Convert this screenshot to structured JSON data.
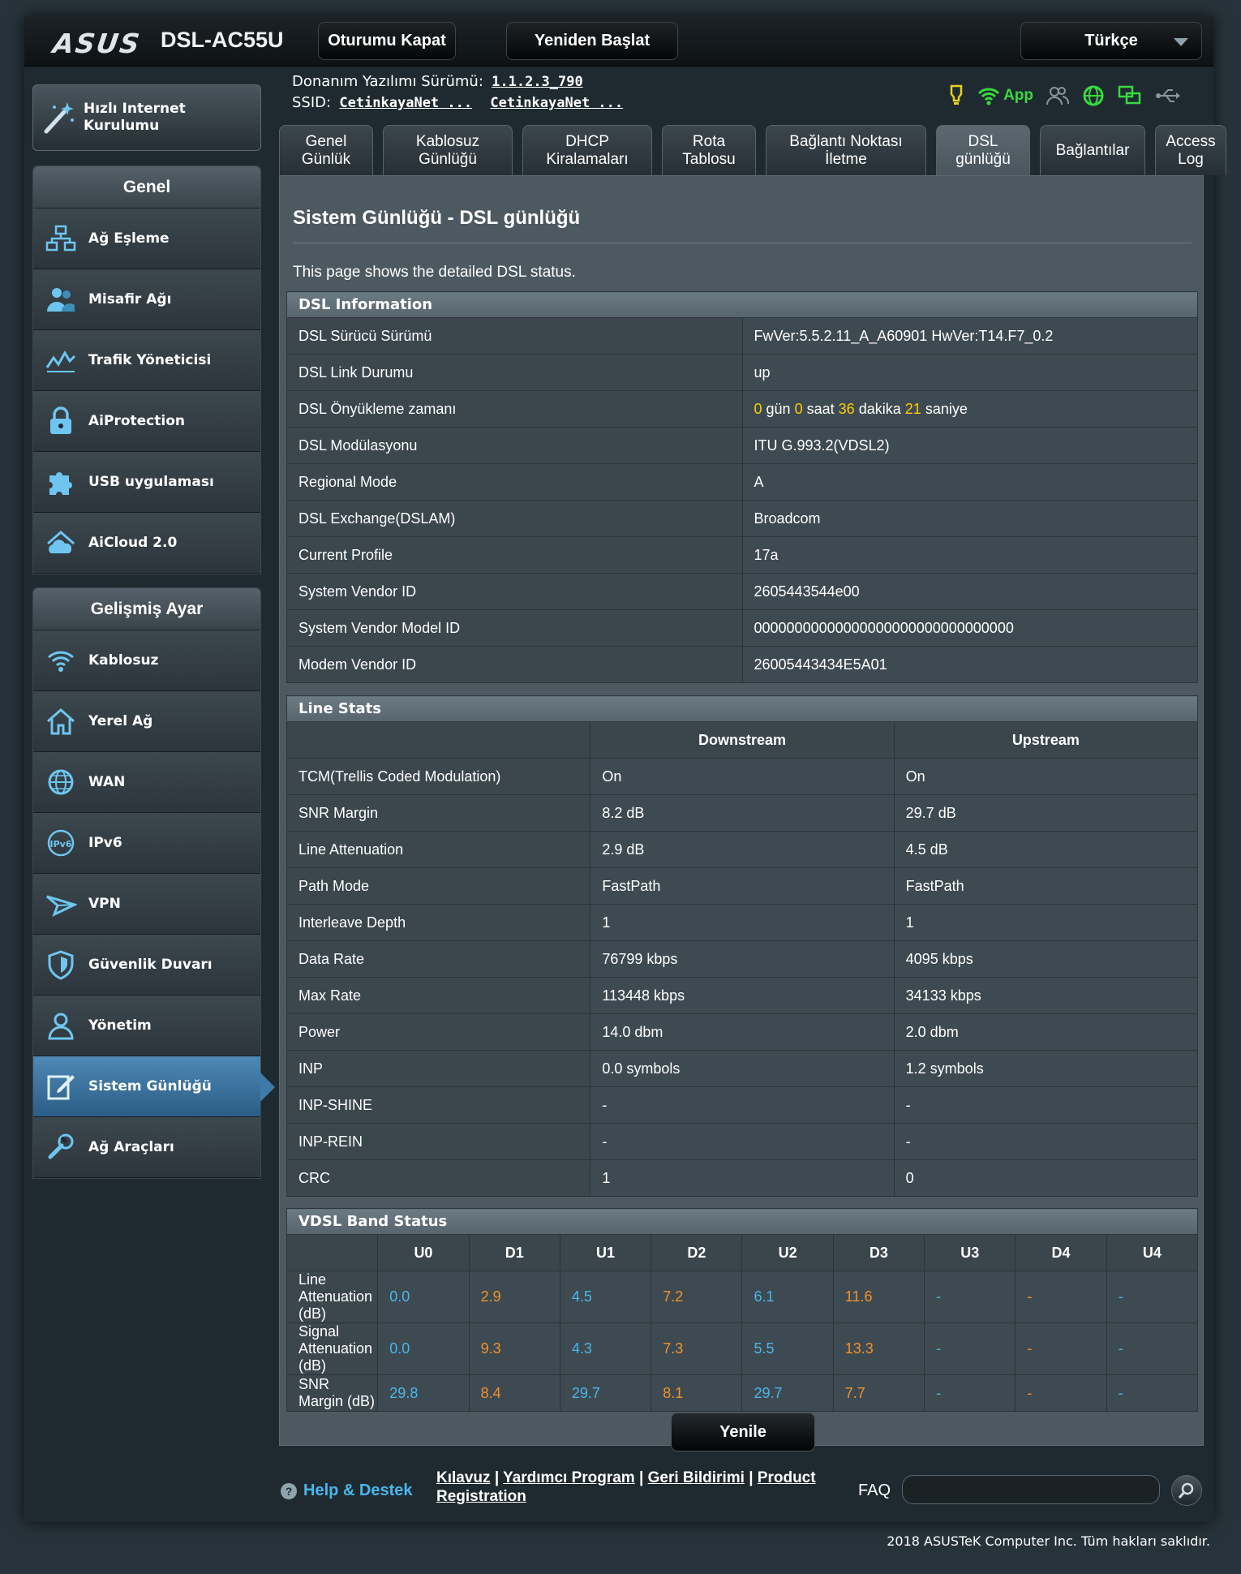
{
  "header": {
    "logo": "ASUS",
    "model": "DSL-AC55U",
    "logout_label": "Oturumu Kapat",
    "reboot_label": "Yeniden Başlat",
    "language": "Türkçe"
  },
  "info": {
    "firmware_label": "Donanım Yazılımı Sürümü:",
    "firmware_value": "1.1.2.3_790",
    "ssid_label": "SSID:",
    "ssid_1": "CetinkayaNet ...",
    "ssid_2": "CetinkayaNet ...",
    "app_label": "App"
  },
  "sidebar": {
    "quick_setup": "Hızlı Internet Kurulumu",
    "general_title": "Genel",
    "general_items": [
      {
        "label": "Ağ Eşleme",
        "icon": "network-map-icon"
      },
      {
        "label": "Misafir Ağı",
        "icon": "guest-network-icon"
      },
      {
        "label": "Trafik Yöneticisi",
        "icon": "traffic-manager-icon"
      },
      {
        "label": "AiProtection",
        "icon": "lock-icon"
      },
      {
        "label": "USB uygulaması",
        "icon": "puzzle-icon"
      },
      {
        "label": "AiCloud 2.0",
        "icon": "cloud-icon"
      }
    ],
    "advanced_title": "Gelişmiş Ayar",
    "advanced_items": [
      {
        "label": "Kablosuz",
        "icon": "wifi-icon"
      },
      {
        "label": "Yerel Ağ",
        "icon": "home-icon"
      },
      {
        "label": "WAN",
        "icon": "globe-icon"
      },
      {
        "label": "IPv6",
        "icon": "ipv6-icon"
      },
      {
        "label": "VPN",
        "icon": "vpn-icon"
      },
      {
        "label": "Güvenlik Duvarı",
        "icon": "shield-icon"
      },
      {
        "label": "Yönetim",
        "icon": "user-icon"
      },
      {
        "label": "Sistem Günlüğü",
        "icon": "log-edit-icon",
        "active": true
      },
      {
        "label": "Ağ Araçları",
        "icon": "tools-icon"
      }
    ]
  },
  "tabs": [
    {
      "label": "Genel\nGünlük"
    },
    {
      "label": "Kablosuz\nGünlüğü"
    },
    {
      "label": "DHCP\nKiralamaları"
    },
    {
      "label": "Rota\nTablosu"
    },
    {
      "label": "Bağlantı Noktası\nİletme"
    },
    {
      "label": "DSL\ngünlüğü",
      "active": true
    },
    {
      "label": "Bağlantılar"
    },
    {
      "label": "Access\nLog"
    }
  ],
  "main": {
    "title": "Sistem Günlüğü - DSL günlüğü",
    "description": "This page shows the detailed DSL status.",
    "refresh_label": "Yenile"
  },
  "dsl_info": {
    "title": "DSL Information",
    "rows": [
      {
        "key": "DSL Sürücü Sürümü",
        "value": "FwVer:5.5.2.11_A_A60901 HwVer:T14.F7_0.2"
      },
      {
        "key": "DSL Link Durumu",
        "value": "up"
      },
      {
        "key": "DSL Önyükleme zamanı",
        "value": "uptime"
      },
      {
        "key": "DSL Modülasyonu",
        "value": "ITU G.993.2(VDSL2)"
      },
      {
        "key": "Regional Mode",
        "value": "A"
      },
      {
        "key": "DSL Exchange(DSLAM)",
        "value": "Broadcom"
      },
      {
        "key": "Current Profile",
        "value": "17a"
      },
      {
        "key": "System Vendor ID",
        "value": "2605443544e00"
      },
      {
        "key": "System Vendor Model ID",
        "value": "00000000000000000000000000000000"
      },
      {
        "key": "Modem Vendor ID",
        "value": "26005443434E5A01"
      }
    ],
    "uptime": {
      "days": "0",
      "days_label": "gün",
      "hours": "0",
      "hours_label": "saat",
      "minutes": "36",
      "minutes_label": "dakika",
      "seconds": "21",
      "seconds_label": "saniye"
    }
  },
  "line_stats": {
    "title": "Line Stats",
    "columns": [
      "Downstream",
      "Upstream"
    ],
    "rows": [
      {
        "key": "TCM(Trellis Coded Modulation)",
        "down": "On",
        "up": "On"
      },
      {
        "key": "SNR Margin",
        "down": "8.2 dB",
        "up": "29.7 dB"
      },
      {
        "key": "Line Attenuation",
        "down": "2.9 dB",
        "up": "4.5 dB"
      },
      {
        "key": "Path Mode",
        "down": "FastPath",
        "up": "FastPath"
      },
      {
        "key": "Interleave Depth",
        "down": "1",
        "up": "1"
      },
      {
        "key": "Data Rate",
        "down": "76799 kbps",
        "up": "4095 kbps"
      },
      {
        "key": "Max Rate",
        "down": "113448 kbps",
        "up": "34133 kbps"
      },
      {
        "key": "Power",
        "down": "14.0 dbm",
        "up": "2.0 dbm"
      },
      {
        "key": "INP",
        "down": "0.0 symbols",
        "up": "1.2 symbols"
      },
      {
        "key": "INP-SHINE",
        "down": "-",
        "up": "-"
      },
      {
        "key": "INP-REIN",
        "down": "-",
        "up": "-"
      },
      {
        "key": "CRC",
        "down": "1",
        "up": "0"
      }
    ]
  },
  "vdsl_band": {
    "title": "VDSL Band Status",
    "bands": [
      "U0",
      "D1",
      "U1",
      "D2",
      "U2",
      "D3",
      "U3",
      "D4",
      "U4"
    ],
    "rows": [
      {
        "key": "Line Attenuation (dB)",
        "values": [
          "0.0",
          "2.9",
          "4.5",
          "7.2",
          "6.1",
          "11.6",
          "-",
          "-",
          "-"
        ]
      },
      {
        "key": "Signal Attenuation (dB)",
        "values": [
          "0.0",
          "9.3",
          "4.3",
          "7.3",
          "5.5",
          "13.3",
          "-",
          "-",
          "-"
        ]
      },
      {
        "key": "SNR Margin (dB)",
        "values": [
          "29.8",
          "8.4",
          "29.7",
          "8.1",
          "29.7",
          "7.7",
          "-",
          "-",
          "-"
        ]
      }
    ],
    "colors": {
      "upstream": "#4ab6ea",
      "downstream": "#f2922a"
    }
  },
  "footer": {
    "help_label": "Help & Destek",
    "link_manual": "Kılavuz",
    "link_utility": "Yardımcı Program",
    "link_feedback": "Geri Bildirimi",
    "link_registration": "Product Registration",
    "separator": "|",
    "faq_label": "FAQ",
    "copyright": "2018 ASUSTeK Computer Inc. Tüm hakları saklıdır."
  }
}
